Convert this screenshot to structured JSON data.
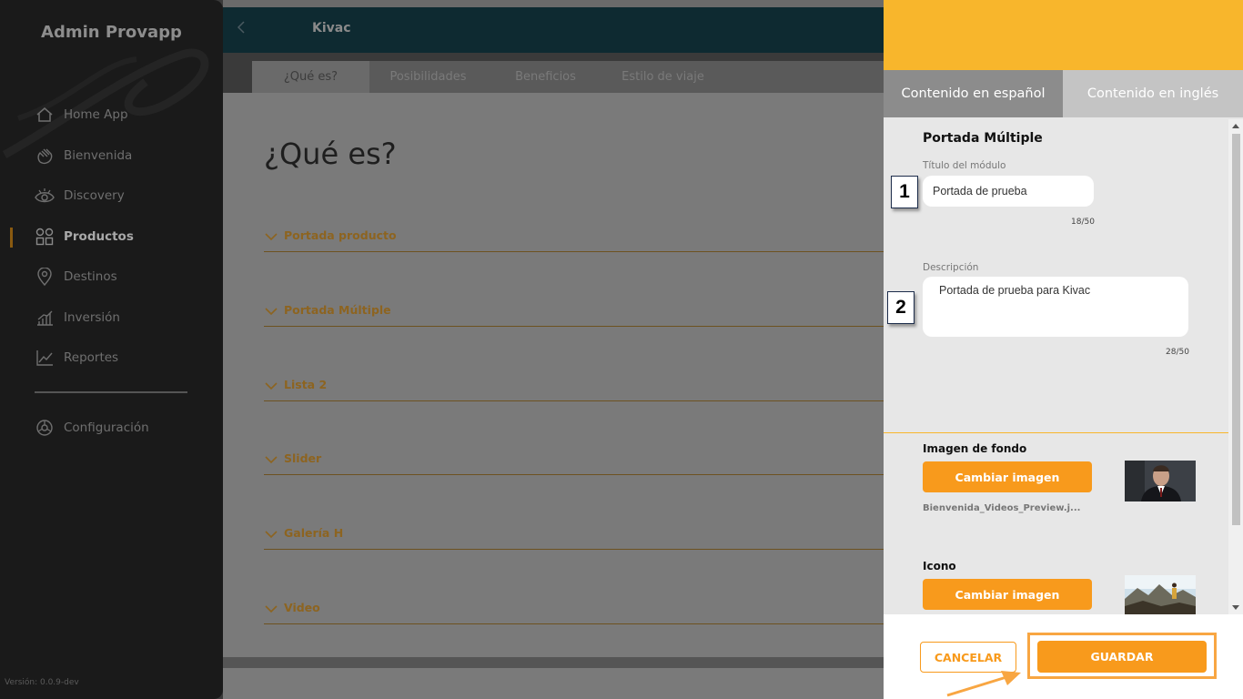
{
  "sidebar": {
    "brand": "Admin Provapp",
    "items": [
      {
        "label": "Home App",
        "icon": "home-icon"
      },
      {
        "label": "Bienvenida",
        "icon": "wave-hand-icon"
      },
      {
        "label": "Discovery",
        "icon": "eye-icon"
      },
      {
        "label": "Productos",
        "icon": "grid-icon",
        "active": true
      },
      {
        "label": "Destinos",
        "icon": "location-pin-icon"
      },
      {
        "label": "Inversión",
        "icon": "bar-chart-icon"
      },
      {
        "label": "Reportes",
        "icon": "line-chart-icon"
      },
      {
        "label": "Configuración",
        "icon": "settings-icon"
      }
    ],
    "version": "Versión: 0.0.9-dev"
  },
  "header": {
    "title": "Kivac"
  },
  "tabs": [
    {
      "label": "¿Qué es?",
      "active": true
    },
    {
      "label": "Posibilidades"
    },
    {
      "label": "Beneficios"
    },
    {
      "label": "Estilo de viaje"
    }
  ],
  "main": {
    "heading": "¿Qué es?",
    "accordions": [
      "Portada producto",
      "Portada Múltiple",
      "Lista 2",
      "Slider",
      "Galería H",
      "Video"
    ]
  },
  "panel": {
    "tabs": {
      "es": "Contenido en español",
      "en": "Contenido en inglés"
    },
    "section_title": "Portada Múltiple",
    "title_field": {
      "label": "Título del módulo",
      "value": "Portada de prueba",
      "counter": "18/50"
    },
    "desc_field": {
      "label": "Descripción",
      "value": "Portada de prueba para Kivac",
      "counter": "28/50"
    },
    "bg_image": {
      "label": "Imagen de fondo",
      "button": "Cambiar imagen",
      "filename": "Bienvenida_Videos_Preview.j..."
    },
    "icon_image": {
      "label": "Icono",
      "button": "Cambiar imagen"
    },
    "buttons": {
      "cancel": "CANCELAR",
      "save": "GUARDAR"
    }
  },
  "annotations": {
    "one": "1",
    "two": "2"
  },
  "colors": {
    "accent": "#f8b62c",
    "button": "#f89a1c",
    "sidebar": "#1a1a1a",
    "header": "#0e2a31"
  }
}
